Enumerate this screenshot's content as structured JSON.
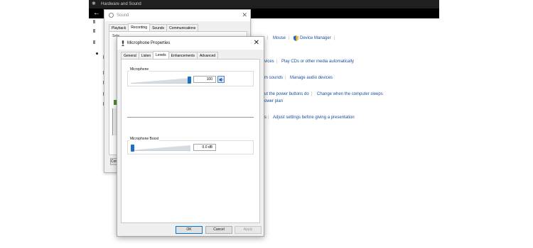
{
  "control_panel": {
    "title": "Hardware and Sound",
    "icons": {
      "app": "hardware-and-sound-icon",
      "back": "back-arrow-icon",
      "shield": "uac-shield-icon"
    },
    "rows": [
      {
        "links": [
          "Mouse",
          "Device Manager"
        ]
      },
      {
        "links": [
          "vices",
          "Play CDs or other media automatically"
        ]
      },
      {
        "links": [
          "m sounds",
          "Manage audio devices"
        ]
      },
      {
        "links": [
          "ut the power buttons do",
          "Change when the computer sleeps",
          "ower plan"
        ]
      },
      {
        "links": [
          "s",
          "Adjust settings before giving a presentation"
        ]
      }
    ],
    "left_stubs": [
      "S",
      "C",
      "S",
      "P",
      "l",
      "N",
      "A",
      "C",
      "E"
    ]
  },
  "sound_dialog": {
    "title": "Sound",
    "tabs": [
      "Playback",
      "Recording",
      "Sounds",
      "Communications"
    ],
    "active_tab": "Recording",
    "first_line": "Sele",
    "buttons": {
      "configure": "Configure"
    }
  },
  "mic_dialog": {
    "title": "Microphone Properties",
    "tabs": [
      "General",
      "Listen",
      "Levels",
      "Enhancements",
      "Advanced"
    ],
    "active_tab": "Levels",
    "microphone": {
      "label": "Microphone",
      "value": "100",
      "level_fraction": 1.0
    },
    "boost": {
      "label": "Microphone Boost",
      "value": "0.0 dB",
      "level_fraction": 0.0
    },
    "buttons": {
      "ok": "OK",
      "cancel": "Cancel",
      "apply": "Apply"
    }
  },
  "colors": {
    "accent": "#1f6fc2",
    "link": "#1a4fa0",
    "titlebar_dark": "#1f1f1f"
  }
}
